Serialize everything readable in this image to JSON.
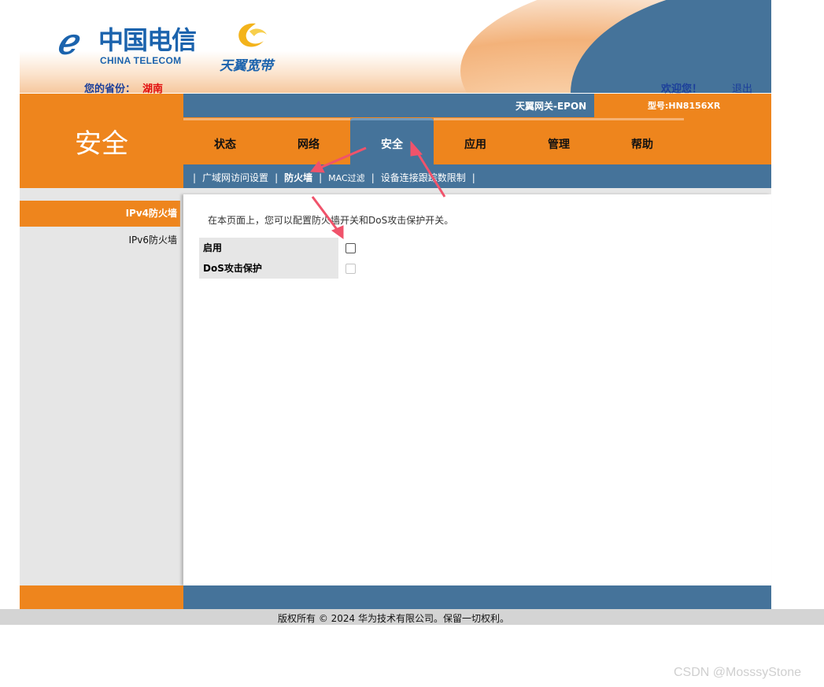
{
  "header": {
    "logo_cn": "中国电信",
    "logo_en": "CHINA TELECOM",
    "brand_tagline": "天翼宽带",
    "province_label": "您的省份：",
    "province_value": "湖南",
    "welcome": "欢迎您！",
    "logout": "退出",
    "gateway_name": "天翼网关-EPON",
    "model": "型号:HN8156XR"
  },
  "section_title": "安全",
  "tabs": [
    {
      "label": "状态",
      "active": false
    },
    {
      "label": "网络",
      "active": false
    },
    {
      "label": "安全",
      "active": true
    },
    {
      "label": "应用",
      "active": false
    },
    {
      "label": "管理",
      "active": false
    },
    {
      "label": "帮助",
      "active": false
    }
  ],
  "subnav": {
    "items": [
      "广域网访问设置",
      "防火墙",
      "MAC过滤",
      "设备连接跟踪数限制"
    ],
    "separator": "|",
    "current": "防火墙"
  },
  "sidebar": {
    "items": [
      {
        "label": "IPv4防火墙",
        "active": true
      },
      {
        "label": "IPv6防火墙",
        "active": false
      }
    ]
  },
  "content": {
    "intro": "在本页面上，您可以配置防火墙开关和DoS攻击保护开关。",
    "fields": [
      {
        "label": "启用",
        "checked": false,
        "disabled": false
      },
      {
        "label": "DoS攻击保护",
        "checked": false,
        "disabled": true
      }
    ]
  },
  "footer": {
    "copyright": "版权所有 © 2024 华为技术有限公司。保留一切权利。"
  },
  "watermark": "CSDN @MosssyStone",
  "colors": {
    "orange": "#ee851d",
    "blue": "#45739a",
    "brand_blue": "#1b63ad",
    "arrow": "#f0536b"
  }
}
